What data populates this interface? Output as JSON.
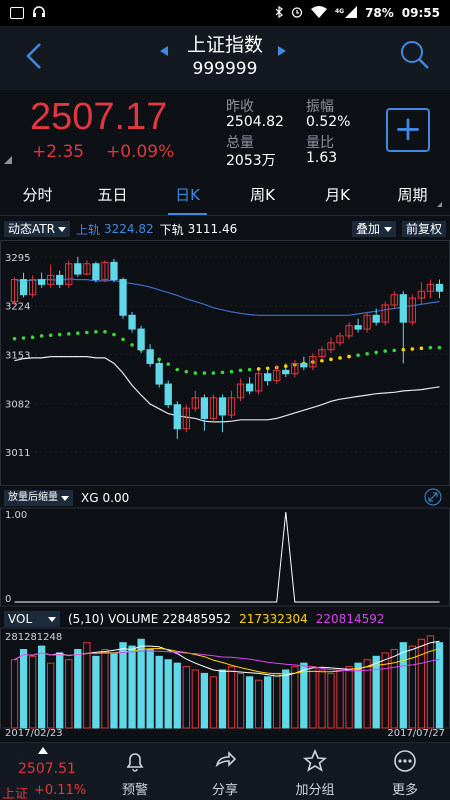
{
  "status": {
    "signal_label": "4G",
    "battery": "78%",
    "time": "09:55"
  },
  "header": {
    "title": "上证指数",
    "code": "999999"
  },
  "quote": {
    "price": "2507.17",
    "change": "+2.35",
    "change_pct": "+0.09%",
    "stats": [
      {
        "label": "昨收",
        "value": "2504.82"
      },
      {
        "label": "振幅",
        "value": "0.52%"
      },
      {
        "label": "总量",
        "value": "2053万"
      },
      {
        "label": "量比",
        "value": "1.63"
      }
    ]
  },
  "tabs": [
    "分时",
    "五日",
    "日K",
    "周K",
    "月K",
    "周期"
  ],
  "main_indicator": {
    "name": "动态ATR",
    "upper_label": "上轨",
    "upper_value": "3224.82",
    "lower_label": "下轨",
    "lower_value": "3111.46",
    "overlay_btn": "叠加",
    "adjust_btn": "前复权"
  },
  "sub_indicator": {
    "name": "放量后缩量",
    "label": "XG",
    "value": "0.00"
  },
  "vol_indicator": {
    "name": "VOL",
    "params": "(5,10)",
    "label": "VOLUME",
    "v1": "228485952",
    "v2": "217332304",
    "v3": "220814592"
  },
  "colors": {
    "up": "#e0383e",
    "down": "#5fd8e8",
    "accent": "#3d8ae0",
    "green": "#3ad43a",
    "yellow": "#ffd700",
    "magenta": "#d946ef"
  },
  "nav": {
    "price": "2507.51",
    "name": "上证",
    "pct": "+0.11%",
    "items": [
      {
        "label": "预警",
        "icon": "bell-icon"
      },
      {
        "label": "分享",
        "icon": "share-icon"
      },
      {
        "label": "加分组",
        "icon": "star-icon"
      },
      {
        "label": "更多",
        "icon": "more-icon"
      }
    ]
  },
  "chart_data": [
    {
      "type": "candlestick",
      "title": "",
      "y_ticks": [
        "3295",
        "3224",
        "3153",
        "3082",
        "3011"
      ],
      "ylim": [
        2985,
        3305
      ],
      "series": [
        {
          "name": "上轨",
          "values": [
            3262,
            3260,
            3261,
            3262,
            3262,
            3261,
            3263,
            3262,
            3262,
            3260,
            3260,
            3261,
            3258,
            3256,
            3254,
            3251,
            3247,
            3243,
            3239,
            3234,
            3230,
            3226,
            3221,
            3218,
            3215,
            3213,
            3211,
            3210,
            3210,
            3210,
            3210,
            3210,
            3210,
            3210,
            3210,
            3210,
            3210,
            3210,
            3212,
            3214,
            3216,
            3218,
            3220,
            3222,
            3224,
            3226,
            3228,
            3230
          ]
        },
        {
          "name": "下轨",
          "values": [
            3144,
            3147,
            3148,
            3148,
            3150,
            3150,
            3150,
            3150,
            3150,
            3148,
            3148,
            3140,
            3126,
            3108,
            3094,
            3081,
            3074,
            3067,
            3064,
            3062,
            3060,
            3056,
            3055,
            3055,
            3056,
            3058,
            3058,
            3058,
            3058,
            3060,
            3064,
            3068,
            3072,
            3076,
            3080,
            3085,
            3088,
            3090,
            3092,
            3094,
            3096,
            3097,
            3098,
            3100,
            3101,
            3102,
            3104,
            3106
          ]
        },
        {
          "name": "中轨",
          "values": [
            3176,
            3177,
            3178,
            3180,
            3181,
            3182,
            3183,
            3184,
            3185,
            3186,
            3186,
            3182,
            3175,
            3167,
            3160,
            3153,
            3146,
            3139,
            3131,
            3128,
            3126,
            3126,
            3126,
            3127,
            3128,
            3130,
            3131,
            3132,
            3133,
            3134,
            3136,
            3138,
            3140,
            3142,
            3144,
            3146,
            3148,
            3150,
            3152,
            3154,
            3156,
            3158,
            3159,
            3160,
            3161,
            3162,
            3163,
            3163
          ]
        }
      ],
      "candles": [
        [
          3230,
          3262,
          3225,
          3265
        ],
        [
          3262,
          3240,
          3236,
          3272
        ],
        [
          3240,
          3262,
          3236,
          3268
        ],
        [
          3262,
          3255,
          3250,
          3272
        ],
        [
          3255,
          3268,
          3250,
          3284
        ],
        [
          3268,
          3255,
          3250,
          3275
        ],
        [
          3255,
          3285,
          3250,
          3290
        ],
        [
          3285,
          3270,
          3266,
          3295
        ],
        [
          3270,
          3285,
          3268,
          3290
        ],
        [
          3285,
          3262,
          3258,
          3288
        ],
        [
          3262,
          3287,
          3258,
          3290
        ],
        [
          3287,
          3262,
          3258,
          3292
        ],
        [
          3262,
          3210,
          3205,
          3265
        ],
        [
          3210,
          3190,
          3185,
          3215
        ],
        [
          3190,
          3160,
          3155,
          3195
        ],
        [
          3160,
          3140,
          3135,
          3168
        ],
        [
          3140,
          3110,
          3105,
          3145
        ],
        [
          3110,
          3080,
          3075,
          3115
        ],
        [
          3080,
          3045,
          3030,
          3085
        ],
        [
          3045,
          3075,
          3040,
          3080
        ],
        [
          3075,
          3090,
          3070,
          3100
        ],
        [
          3090,
          3060,
          3042,
          3095
        ],
        [
          3060,
          3090,
          3055,
          3095
        ],
        [
          3090,
          3065,
          3040,
          3095
        ],
        [
          3065,
          3090,
          3060,
          3100
        ],
        [
          3090,
          3110,
          3085,
          3118
        ],
        [
          3110,
          3100,
          3095,
          3120
        ],
        [
          3100,
          3125,
          3095,
          3130
        ],
        [
          3125,
          3115,
          3108,
          3135
        ],
        [
          3115,
          3130,
          3110,
          3138
        ],
        [
          3130,
          3125,
          3120,
          3140
        ],
        [
          3125,
          3140,
          3120,
          3145
        ],
        [
          3140,
          3135,
          3130,
          3150
        ],
        [
          3135,
          3150,
          3130,
          3155
        ],
        [
          3150,
          3160,
          3145,
          3165
        ],
        [
          3160,
          3170,
          3155,
          3178
        ],
        [
          3170,
          3180,
          3165,
          3185
        ],
        [
          3180,
          3195,
          3175,
          3200
        ],
        [
          3195,
          3190,
          3185,
          3205
        ],
        [
          3190,
          3210,
          3185,
          3215
        ],
        [
          3210,
          3200,
          3195,
          3220
        ],
        [
          3200,
          3225,
          3195,
          3230
        ],
        [
          3225,
          3240,
          3220,
          3245
        ],
        [
          3240,
          3200,
          3140,
          3245
        ],
        [
          3200,
          3235,
          3195,
          3240
        ],
        [
          3235,
          3245,
          3225,
          3258
        ],
        [
          3245,
          3255,
          3235,
          3262
        ],
        [
          3255,
          3245,
          3235,
          3262
        ]
      ]
    },
    {
      "type": "line",
      "title": "",
      "y_ticks": [
        "1.00",
        "0"
      ],
      "values": [
        0,
        0,
        0,
        0,
        0,
        0,
        0,
        0,
        0,
        0,
        0,
        0,
        0,
        0,
        0,
        0,
        0,
        0,
        0,
        0,
        0,
        0,
        0,
        0,
        0,
        0,
        0,
        0,
        0,
        0,
        1,
        0,
        0,
        0,
        0,
        0,
        0,
        0,
        0,
        0,
        0,
        0,
        0,
        0,
        0,
        0,
        0,
        0
      ]
    },
    {
      "type": "bar",
      "title": "",
      "y_ticks": [
        "281281248"
      ],
      "x_labels": [
        "2017/02/23",
        "2017/07/27"
      ],
      "ylim": [
        0,
        281281248
      ],
      "values": [
        200,
        230,
        210,
        240,
        190,
        220,
        200,
        230,
        250,
        210,
        230,
        220,
        250,
        240,
        260,
        230,
        210,
        200,
        190,
        180,
        170,
        160,
        150,
        170,
        180,
        160,
        150,
        140,
        150,
        160,
        170,
        180,
        190,
        180,
        170,
        160,
        170,
        180,
        190,
        200,
        210,
        220,
        230,
        250,
        240,
        260,
        270,
        250
      ],
      "unit_scale": 1000000
    }
  ]
}
